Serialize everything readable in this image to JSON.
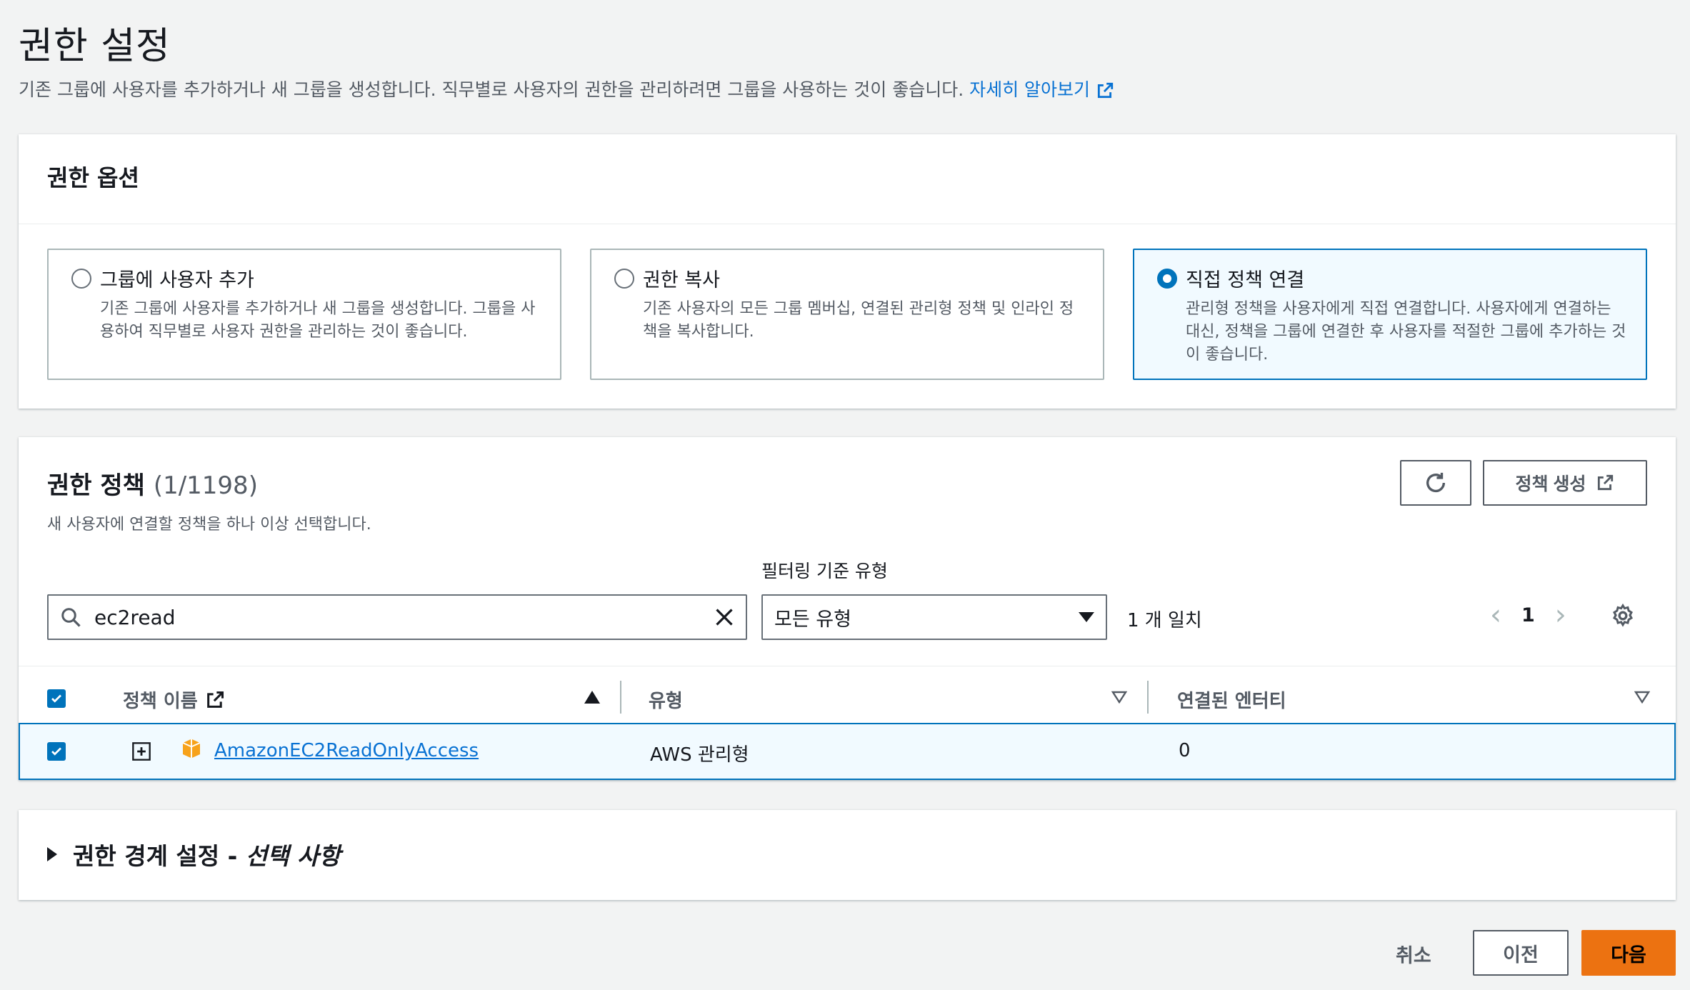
{
  "header": {
    "title": "권한 설정",
    "description": "기존 그룹에 사용자를 추가하거나 새 그룹을 생성합니다. 직무별로 사용자의 권한을 관리하려면 그룹을 사용하는 것이 좋습니다.",
    "learn_more": "자세히 알아보기"
  },
  "options": {
    "title": "권한 옵션",
    "tiles": [
      {
        "label": "그룹에 사용자 추가",
        "desc": "기존 그룹에 사용자를 추가하거나 새 그룹을 생성합니다. 그룹을 사용하여 직무별로 사용자 권한을 관리하는 것이 좋습니다.",
        "selected": false
      },
      {
        "label": "권한 복사",
        "desc": "기존 사용자의 모든 그룹 멤버십, 연결된 관리형 정책 및 인라인 정책을 복사합니다.",
        "selected": false
      },
      {
        "label": "직접 정책 연결",
        "desc": "관리형 정책을 사용자에게 직접 연결합니다. 사용자에게 연결하는 대신, 정책을 그룹에 연결한 후 사용자를 적절한 그룹에 추가하는 것이 좋습니다.",
        "selected": true
      }
    ]
  },
  "policies": {
    "title": "권한 정책",
    "count": "(1/1198)",
    "subtitle": "새 사용자에 연결할 정책을 하나 이상 선택합니다.",
    "create_label": "정책 생성",
    "filter_label": "필터링 기준 유형",
    "search_value": "ec2read",
    "filter_value": "모든 유형",
    "matches": "1 개 일치",
    "page": "1",
    "columns": [
      "정책 이름",
      "유형",
      "연결된 엔터티"
    ],
    "rows": [
      {
        "name": "AmazonEC2ReadOnlyAccess",
        "type": "AWS 관리형",
        "entities": "0",
        "checked": true
      }
    ]
  },
  "boundary": {
    "title": "권한 경계 설정 -",
    "optional": "선택 사항"
  },
  "footer": {
    "cancel": "취소",
    "prev": "이전",
    "next": "다음"
  },
  "colors": {
    "accent": "#0073bb",
    "primary_button": "#ec7211",
    "link": "#0972d3"
  }
}
